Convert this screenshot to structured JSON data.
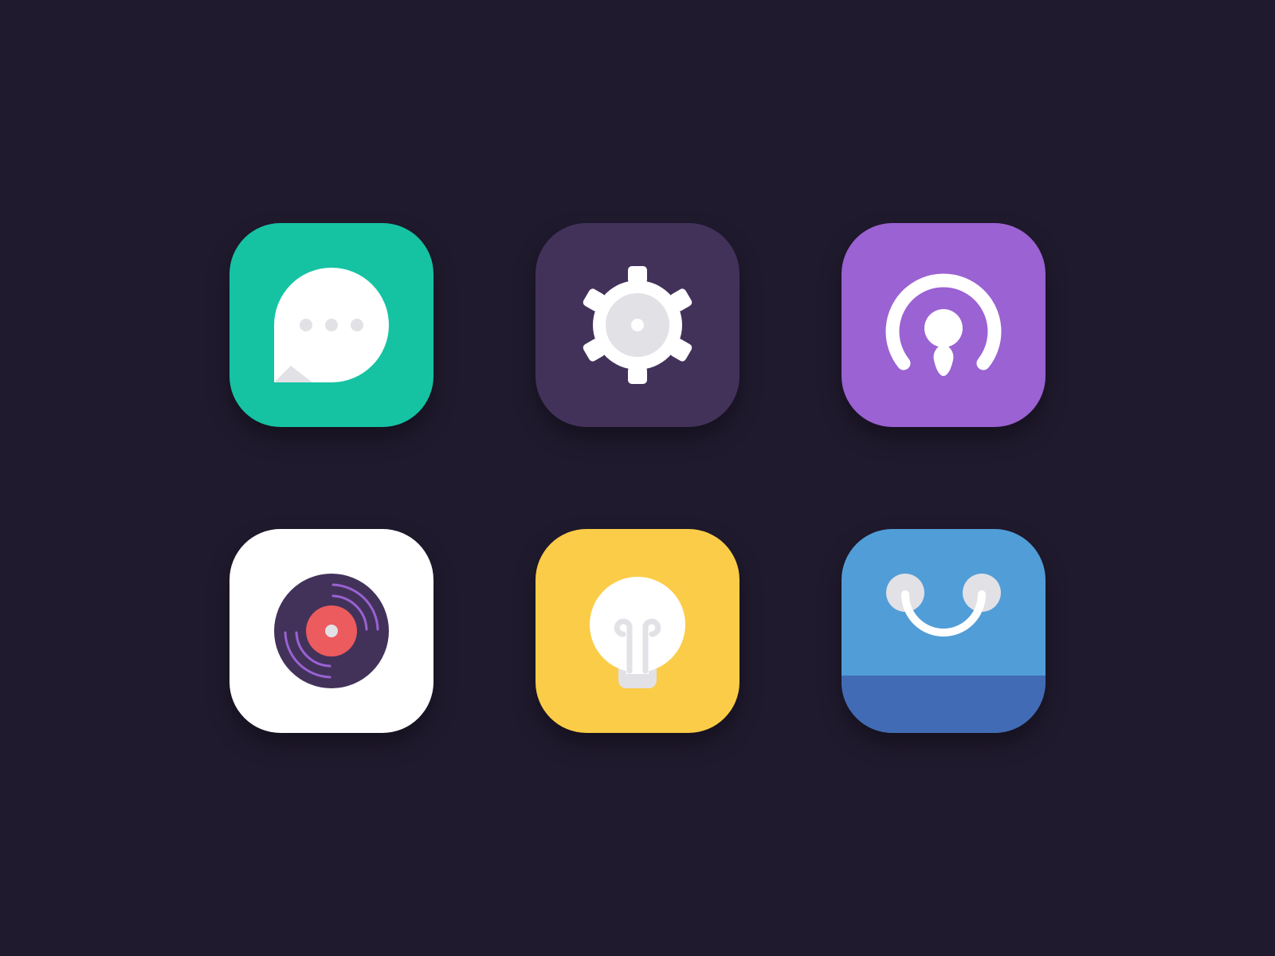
{
  "background": "#201a2e",
  "icons": [
    {
      "key": "messages",
      "symbol": "speech-bubble-icon",
      "bg": "#15c3a3"
    },
    {
      "key": "settings",
      "symbol": "gear-icon",
      "bg": "#42325a"
    },
    {
      "key": "podcast",
      "symbol": "podcast-icon",
      "bg": "#9a62d2"
    },
    {
      "key": "music",
      "symbol": "vinyl-record-icon",
      "bg": "#ffffff",
      "accent": "#ec5b5e"
    },
    {
      "key": "ideas",
      "symbol": "lightbulb-icon",
      "bg": "#fbcc47"
    },
    {
      "key": "store",
      "symbol": "shopping-bag-icon",
      "bg": "#519dd7",
      "band": "#426bb5"
    }
  ]
}
